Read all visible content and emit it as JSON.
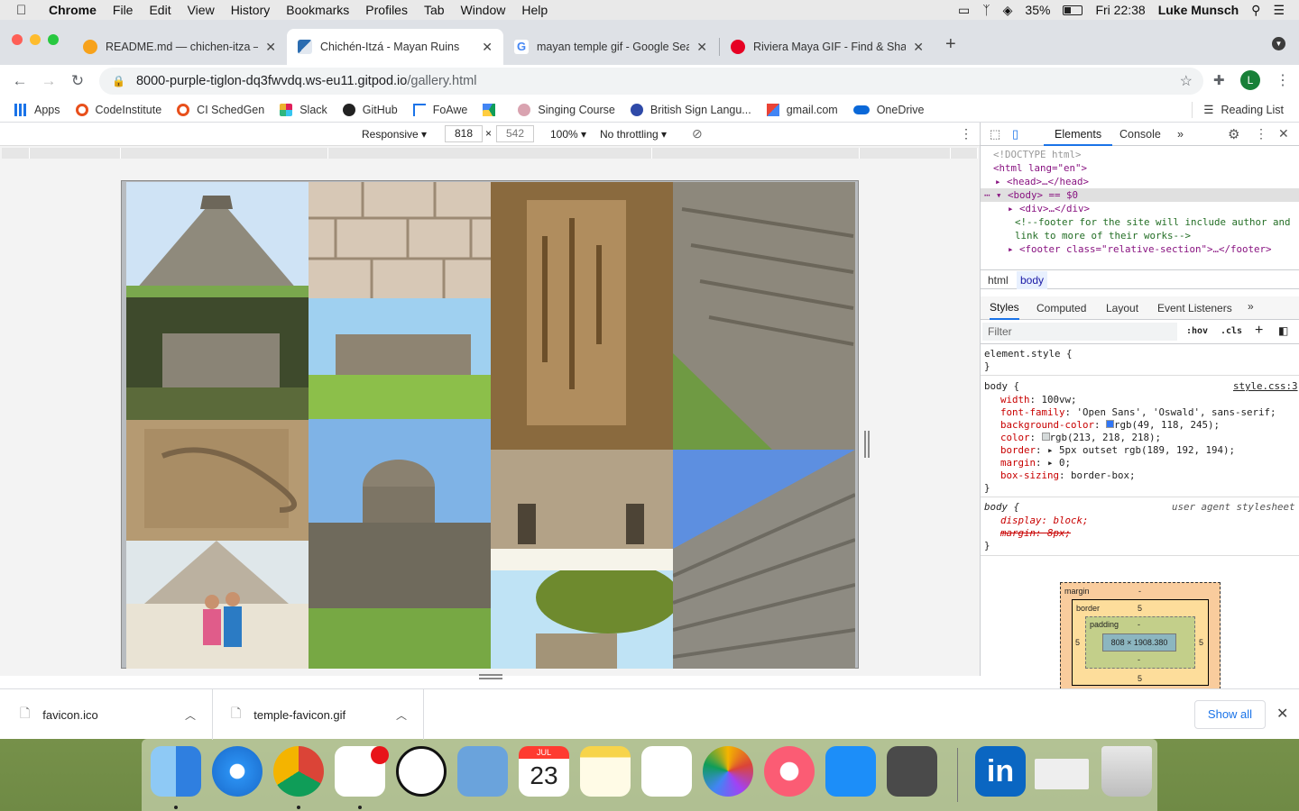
{
  "menubar": {
    "app": "Chrome",
    "items": [
      "File",
      "Edit",
      "View",
      "History",
      "Bookmarks",
      "Profiles",
      "Tab",
      "Window",
      "Help"
    ],
    "battery": "35%",
    "clock": "Fri 22:38",
    "user": "Luke Munsch"
  },
  "tabs": [
    {
      "title": "README.md — chichen-itza — ",
      "active": false
    },
    {
      "title": "Chichén-Itzá - Mayan Ruins",
      "active": true
    },
    {
      "title": "mayan temple gif - Google Sea",
      "active": false
    },
    {
      "title": "Riviera Maya GIF - Find & Shar",
      "active": false
    }
  ],
  "address": {
    "host": "8000-purple-tiglon-dq3fwvdq.ws-eu11.gitpod.io",
    "path": "/gallery.html"
  },
  "profile_initial": "L",
  "bookmarks": [
    "Apps",
    "CodeInstitute",
    "CI SchedGen",
    "Slack",
    "GitHub",
    "FoAwe",
    "",
    "Singing Course",
    "British Sign Langu...",
    "gmail.com",
    "OneDrive"
  ],
  "reading_list": "Reading List",
  "device_toolbar": {
    "mode": "Responsive",
    "width": "818",
    "height": "542",
    "zoom": "100%",
    "throttle": "No throttling"
  },
  "devtools": {
    "tabs": [
      "Elements",
      "Console"
    ],
    "dom": {
      "doctype": "<!DOCTYPE html>",
      "html_open": "<html lang=\"en\">",
      "head": "<head>…</head>",
      "body": "<body> == $0",
      "div": "<div>…</div>",
      "comment_1": "<!--footer for the site will include author and",
      "comment_2": "link to more of their works-->",
      "footer": "<footer class=\"relative-section\">…</footer>"
    },
    "crumbs": [
      "html",
      "body"
    ],
    "style_tabs": [
      "Styles",
      "Computed",
      "Layout",
      "Event Listeners"
    ],
    "filter_placeholder": "Filter",
    "hov": ":hov",
    "cls": ".cls",
    "element_style": "element.style {",
    "body_rule": {
      "selector": "body {",
      "source": "style.css:3",
      "props": [
        {
          "name": "width",
          "value": "100vw;"
        },
        {
          "name": "font-family",
          "value": "'Open Sans', 'Oswald', sans-serif;"
        },
        {
          "name": "background-color",
          "value": "rgb(49, 118, 245);"
        },
        {
          "name": "color",
          "value": "rgb(213, 218, 218);"
        },
        {
          "name": "border",
          "value": "5px outset rgb(189, 192, 194);"
        },
        {
          "name": "margin",
          "value": "0;"
        },
        {
          "name": "box-sizing",
          "value": "border-box;"
        }
      ]
    },
    "ua_rule": {
      "selector": "body {",
      "source": "user agent stylesheet",
      "display": "display: block;",
      "margin": "margin: 8px;"
    },
    "box_model": {
      "margin": "margin",
      "border": "border",
      "padding": "padding",
      "content": "808 × 1908.380",
      "border_val": "5",
      "dash": "-"
    },
    "close_brace": "}"
  },
  "downloads": [
    {
      "name": "favicon.ico"
    },
    {
      "name": "temple-favicon.gif"
    }
  ],
  "show_all": "Show all",
  "calendar": {
    "month": "JUL",
    "day": "23"
  }
}
